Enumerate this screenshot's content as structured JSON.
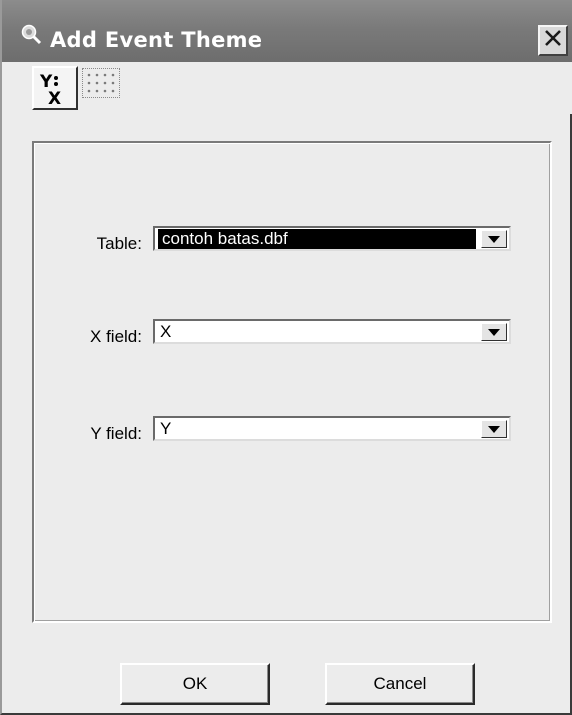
{
  "window": {
    "title": "Add Event Theme"
  },
  "toolbar": {
    "tools": [
      {
        "icon": "yx-xy-event-icon",
        "label": "Y X",
        "active": true
      },
      {
        "icon": "dotted-table-icon",
        "active": false
      }
    ]
  },
  "form": {
    "table_label": "Table:",
    "table_value": "contoh batas.dbf",
    "x_label": "X field:",
    "x_value": "X",
    "y_label": "Y field:",
    "y_value": "Y"
  },
  "buttons": {
    "ok": "OK",
    "cancel": "Cancel"
  }
}
